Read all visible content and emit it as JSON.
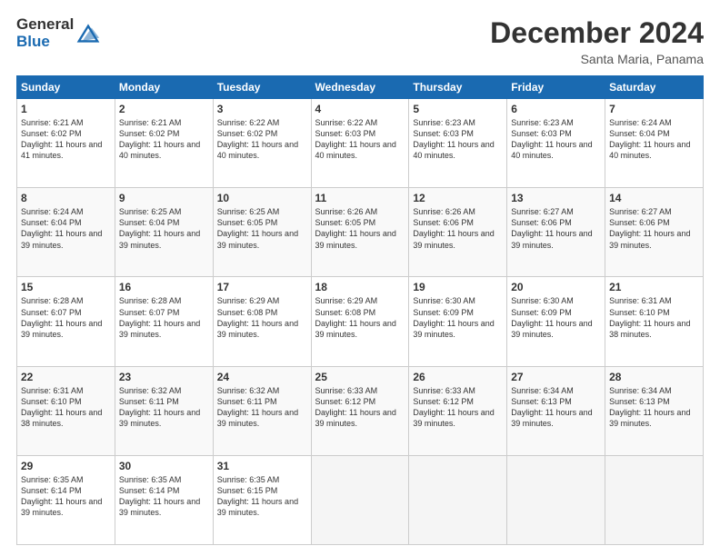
{
  "logo": {
    "line1": "General",
    "line2": "Blue"
  },
  "title": "December 2024",
  "subtitle": "Santa Maria, Panama",
  "days_header": [
    "Sunday",
    "Monday",
    "Tuesday",
    "Wednesday",
    "Thursday",
    "Friday",
    "Saturday"
  ],
  "weeks": [
    [
      {
        "day": "1",
        "sunrise": "6:21 AM",
        "sunset": "6:02 PM",
        "daylight": "11 hours and 41 minutes."
      },
      {
        "day": "2",
        "sunrise": "6:21 AM",
        "sunset": "6:02 PM",
        "daylight": "11 hours and 40 minutes."
      },
      {
        "day": "3",
        "sunrise": "6:22 AM",
        "sunset": "6:02 PM",
        "daylight": "11 hours and 40 minutes."
      },
      {
        "day": "4",
        "sunrise": "6:22 AM",
        "sunset": "6:03 PM",
        "daylight": "11 hours and 40 minutes."
      },
      {
        "day": "5",
        "sunrise": "6:23 AM",
        "sunset": "6:03 PM",
        "daylight": "11 hours and 40 minutes."
      },
      {
        "day": "6",
        "sunrise": "6:23 AM",
        "sunset": "6:03 PM",
        "daylight": "11 hours and 40 minutes."
      },
      {
        "day": "7",
        "sunrise": "6:24 AM",
        "sunset": "6:04 PM",
        "daylight": "11 hours and 40 minutes."
      }
    ],
    [
      {
        "day": "8",
        "sunrise": "6:24 AM",
        "sunset": "6:04 PM",
        "daylight": "11 hours and 39 minutes."
      },
      {
        "day": "9",
        "sunrise": "6:25 AM",
        "sunset": "6:04 PM",
        "daylight": "11 hours and 39 minutes."
      },
      {
        "day": "10",
        "sunrise": "6:25 AM",
        "sunset": "6:05 PM",
        "daylight": "11 hours and 39 minutes."
      },
      {
        "day": "11",
        "sunrise": "6:26 AM",
        "sunset": "6:05 PM",
        "daylight": "11 hours and 39 minutes."
      },
      {
        "day": "12",
        "sunrise": "6:26 AM",
        "sunset": "6:06 PM",
        "daylight": "11 hours and 39 minutes."
      },
      {
        "day": "13",
        "sunrise": "6:27 AM",
        "sunset": "6:06 PM",
        "daylight": "11 hours and 39 minutes."
      },
      {
        "day": "14",
        "sunrise": "6:27 AM",
        "sunset": "6:06 PM",
        "daylight": "11 hours and 39 minutes."
      }
    ],
    [
      {
        "day": "15",
        "sunrise": "6:28 AM",
        "sunset": "6:07 PM",
        "daylight": "11 hours and 39 minutes."
      },
      {
        "day": "16",
        "sunrise": "6:28 AM",
        "sunset": "6:07 PM",
        "daylight": "11 hours and 39 minutes."
      },
      {
        "day": "17",
        "sunrise": "6:29 AM",
        "sunset": "6:08 PM",
        "daylight": "11 hours and 39 minutes."
      },
      {
        "day": "18",
        "sunrise": "6:29 AM",
        "sunset": "6:08 PM",
        "daylight": "11 hours and 39 minutes."
      },
      {
        "day": "19",
        "sunrise": "6:30 AM",
        "sunset": "6:09 PM",
        "daylight": "11 hours and 39 minutes."
      },
      {
        "day": "20",
        "sunrise": "6:30 AM",
        "sunset": "6:09 PM",
        "daylight": "11 hours and 39 minutes."
      },
      {
        "day": "21",
        "sunrise": "6:31 AM",
        "sunset": "6:10 PM",
        "daylight": "11 hours and 38 minutes."
      }
    ],
    [
      {
        "day": "22",
        "sunrise": "6:31 AM",
        "sunset": "6:10 PM",
        "daylight": "11 hours and 38 minutes."
      },
      {
        "day": "23",
        "sunrise": "6:32 AM",
        "sunset": "6:11 PM",
        "daylight": "11 hours and 39 minutes."
      },
      {
        "day": "24",
        "sunrise": "6:32 AM",
        "sunset": "6:11 PM",
        "daylight": "11 hours and 39 minutes."
      },
      {
        "day": "25",
        "sunrise": "6:33 AM",
        "sunset": "6:12 PM",
        "daylight": "11 hours and 39 minutes."
      },
      {
        "day": "26",
        "sunrise": "6:33 AM",
        "sunset": "6:12 PM",
        "daylight": "11 hours and 39 minutes."
      },
      {
        "day": "27",
        "sunrise": "6:34 AM",
        "sunset": "6:13 PM",
        "daylight": "11 hours and 39 minutes."
      },
      {
        "day": "28",
        "sunrise": "6:34 AM",
        "sunset": "6:13 PM",
        "daylight": "11 hours and 39 minutes."
      }
    ],
    [
      {
        "day": "29",
        "sunrise": "6:35 AM",
        "sunset": "6:14 PM",
        "daylight": "11 hours and 39 minutes."
      },
      {
        "day": "30",
        "sunrise": "6:35 AM",
        "sunset": "6:14 PM",
        "daylight": "11 hours and 39 minutes."
      },
      {
        "day": "31",
        "sunrise": "6:35 AM",
        "sunset": "6:15 PM",
        "daylight": "11 hours and 39 minutes."
      },
      null,
      null,
      null,
      null
    ]
  ]
}
